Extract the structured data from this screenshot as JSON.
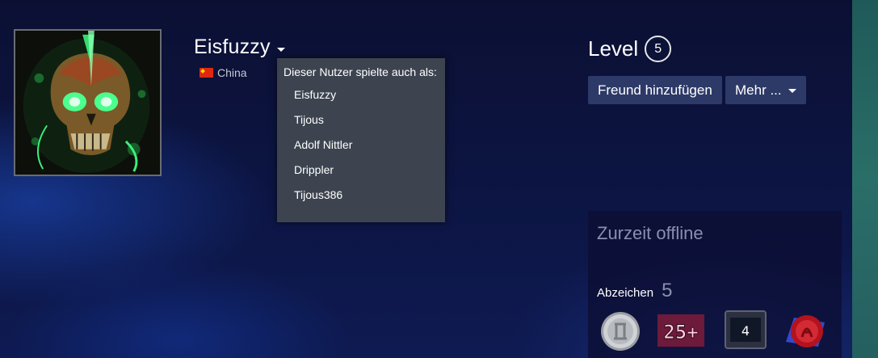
{
  "profile": {
    "persona_name": "Eisfuzzy",
    "location": "China"
  },
  "alias_menu": {
    "header": "Dieser Nutzer spielte auch als:",
    "items": [
      "Eisfuzzy",
      "Tijous",
      "Adolf Nittler",
      "Drippler",
      "Tijous386"
    ]
  },
  "level": {
    "label": "Level",
    "value": "5"
  },
  "actions": {
    "add_friend": "Freund hinzufügen",
    "more": "Mehr ..."
  },
  "status": {
    "text": "Zurzeit offline"
  },
  "badges": {
    "label": "Abzeichen",
    "count": "5",
    "items": [
      {
        "icon": "silver-coin-badge-icon"
      },
      {
        "icon": "years-25-badge-icon",
        "text": "25+"
      },
      {
        "icon": "number-4-badge-icon",
        "text": "4"
      },
      {
        "icon": "red-seal-badge-icon"
      }
    ]
  },
  "colors": {
    "button_bg": "#2d3a68",
    "menu_bg": "#3d4450",
    "muted_text": "#8a8fb0",
    "flag_red": "#de2910"
  }
}
